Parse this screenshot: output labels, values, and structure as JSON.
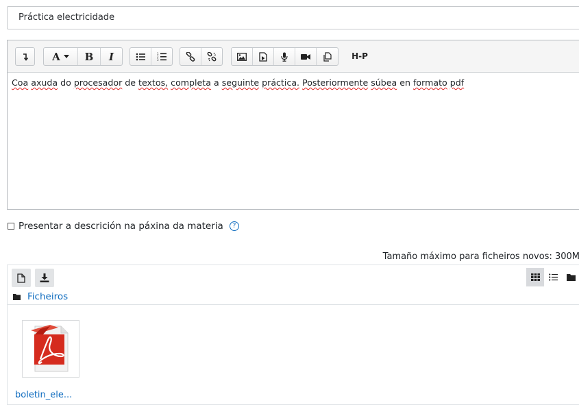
{
  "title_field": {
    "value": "Práctica electricidade"
  },
  "toolbar": {
    "buttons": {
      "toggle": "toggle-toolbar-icon",
      "font_color": "A",
      "bold": "B",
      "italic": "I",
      "bulleted_list": "bulleted-list-icon",
      "numbered_list": "numbered-list-icon",
      "link": "link-icon",
      "unlink": "unlink-icon",
      "image": "image-icon",
      "media": "media-icon",
      "record_audio": "microphone-icon",
      "record_video": "video-camera-icon",
      "manage_files": "manage-files-icon",
      "h5p": "H-P"
    }
  },
  "editor": {
    "words": [
      {
        "t": "Coa",
        "sp": true
      },
      {
        "t": " ",
        "sp": false
      },
      {
        "t": "axuda",
        "sp": true
      },
      {
        "t": " do ",
        "sp": false
      },
      {
        "t": "procesador",
        "sp": true
      },
      {
        "t": " de ",
        "sp": false
      },
      {
        "t": "textos,",
        "sp": true
      },
      {
        "t": " ",
        "sp": false
      },
      {
        "t": "completa",
        "sp": true
      },
      {
        "t": " a ",
        "sp": false
      },
      {
        "t": "seguinte",
        "sp": true
      },
      {
        "t": " ",
        "sp": false
      },
      {
        "t": "práctica.",
        "sp": true
      },
      {
        "t": " ",
        "sp": false
      },
      {
        "t": "Posteriormente",
        "sp": true
      },
      {
        "t": " ",
        "sp": false
      },
      {
        "t": "súbea",
        "sp": true
      },
      {
        "t": " en ",
        "sp": false
      },
      {
        "t": "formato",
        "sp": true
      },
      {
        "t": " ",
        "sp": false
      },
      {
        "t": "pdf",
        "sp": true
      }
    ]
  },
  "show_description": {
    "label": "Presentar a descrición na páxina da materia",
    "checked": false,
    "help": "?"
  },
  "filemanager": {
    "max_size": "Tamaño máximo para ficheiros novos: 300M",
    "path_label": "Ficheiros",
    "files": [
      {
        "name": "boletin_ele...",
        "type": "pdf"
      }
    ],
    "view_modes": [
      "icons",
      "list",
      "tree"
    ],
    "active_view": "icons"
  },
  "colors": {
    "accent": "#0f6cbf",
    "pdf_red": "#d52b1e"
  }
}
